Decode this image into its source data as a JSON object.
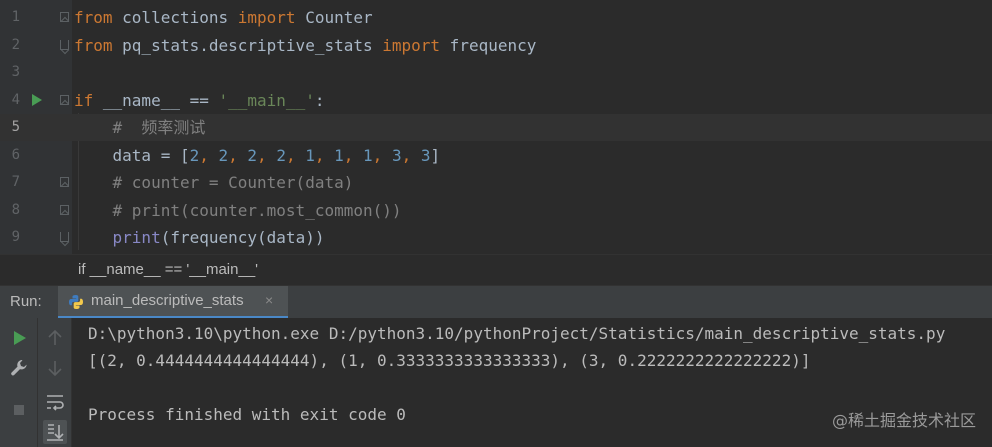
{
  "editor": {
    "lines": [
      {
        "n": "1",
        "segments": [
          {
            "t": "from",
            "c": "kw"
          },
          {
            "t": " collections ",
            "c": ""
          },
          {
            "t": "import",
            "c": "kw"
          },
          {
            "t": " Counter",
            "c": ""
          }
        ]
      },
      {
        "n": "2",
        "segments": [
          {
            "t": "from",
            "c": "kw"
          },
          {
            "t": " pq_stats.descriptive_stats ",
            "c": ""
          },
          {
            "t": "import",
            "c": "kw"
          },
          {
            "t": " frequency",
            "c": ""
          }
        ]
      },
      {
        "n": "3",
        "segments": []
      },
      {
        "n": "4",
        "segments": [
          {
            "t": "if",
            "c": "kw"
          },
          {
            "t": " __name__ == ",
            "c": ""
          },
          {
            "t": "'__main__'",
            "c": "str"
          },
          {
            "t": ":",
            "c": ""
          }
        ]
      },
      {
        "n": "5",
        "segments": [
          {
            "t": "    #  频率测试",
            "c": "cm"
          }
        ]
      },
      {
        "n": "6",
        "segments": [
          {
            "t": "    data = [",
            "c": ""
          },
          {
            "t": "2",
            "c": "num"
          },
          {
            "t": ", ",
            "c": "kw"
          },
          {
            "t": "2",
            "c": "num"
          },
          {
            "t": ", ",
            "c": "kw"
          },
          {
            "t": "2",
            "c": "num"
          },
          {
            "t": ", ",
            "c": "kw"
          },
          {
            "t": "2",
            "c": "num"
          },
          {
            "t": ", ",
            "c": "kw"
          },
          {
            "t": "1",
            "c": "num"
          },
          {
            "t": ", ",
            "c": "kw"
          },
          {
            "t": "1",
            "c": "num"
          },
          {
            "t": ", ",
            "c": "kw"
          },
          {
            "t": "1",
            "c": "num"
          },
          {
            "t": ", ",
            "c": "kw"
          },
          {
            "t": "3",
            "c": "num"
          },
          {
            "t": ", ",
            "c": "kw"
          },
          {
            "t": "3",
            "c": "num"
          },
          {
            "t": "]",
            "c": ""
          }
        ]
      },
      {
        "n": "7",
        "segments": [
          {
            "t": "    # counter = Counter(data)",
            "c": "cm"
          }
        ]
      },
      {
        "n": "8",
        "segments": [
          {
            "t": "    # print(counter.most_common())",
            "c": "cm"
          }
        ]
      },
      {
        "n": "9",
        "segments": [
          {
            "t": "    ",
            "c": ""
          },
          {
            "t": "print",
            "c": "builtin"
          },
          {
            "t": "(frequency(data))",
            "c": ""
          }
        ]
      }
    ]
  },
  "breadcrumb": {
    "text": "if __name__ == '__main__'"
  },
  "run_panel": {
    "label": "Run:",
    "tab_label": "main_descriptive_stats",
    "tab_close": "×"
  },
  "console": {
    "lines": [
      "D:\\python3.10\\python.exe D:/python3.10/pythonProject/Statistics/main_descriptive_stats.py",
      "[(2, 0.4444444444444444), (1, 0.3333333333333333), (3, 0.2222222222222222)]",
      "",
      "Process finished with exit code 0"
    ]
  },
  "watermark": "@稀土掘金技术社区",
  "colors": {
    "keyword": "#cc7832",
    "number": "#6897bb",
    "string": "#6a8759",
    "comment": "#808080",
    "run_green": "#499c54"
  }
}
